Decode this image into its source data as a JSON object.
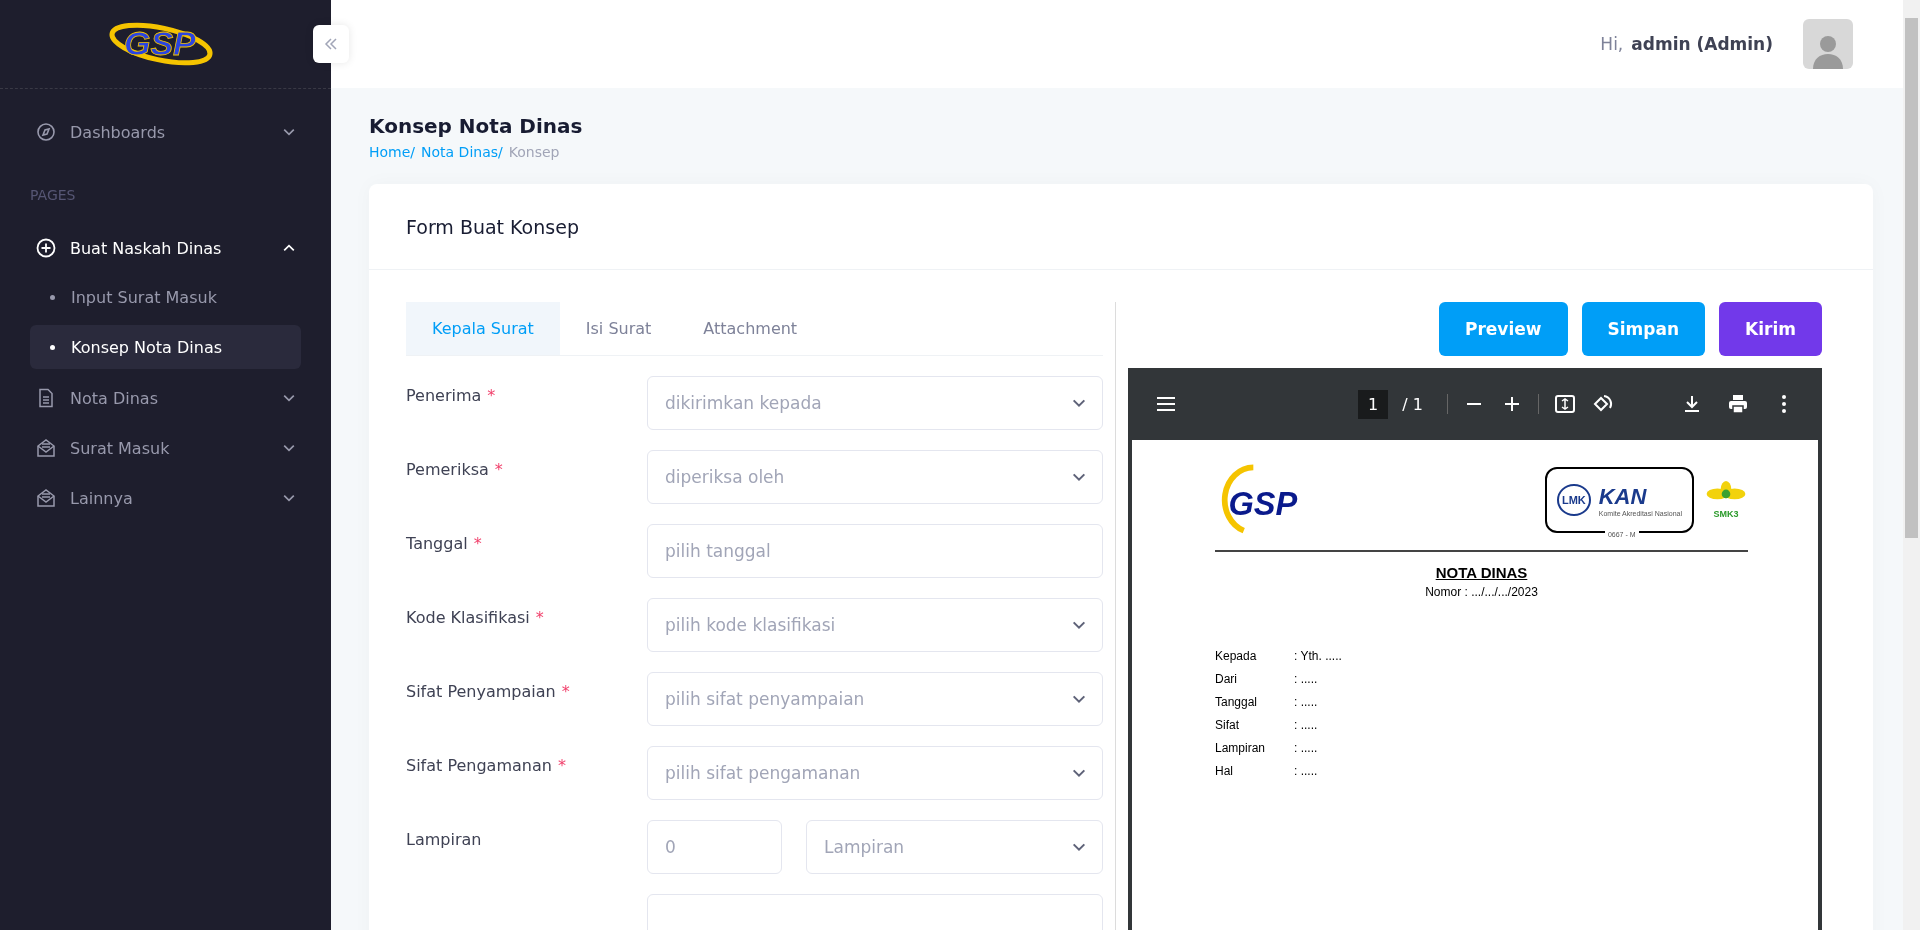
{
  "sidebar": {
    "logo": "GSP",
    "items": [
      {
        "label": "Dashboards",
        "expanded": false
      },
      {
        "label": "Buat Naskah Dinas",
        "expanded": true,
        "section": "PAGES",
        "children": [
          {
            "label": "Input Surat Masuk",
            "selected": false
          },
          {
            "label": "Konsep Nota Dinas",
            "selected": true
          }
        ]
      },
      {
        "label": "Nota Dinas",
        "expanded": false
      },
      {
        "label": "Surat Masuk",
        "expanded": false
      },
      {
        "label": "Lainnya",
        "expanded": false
      }
    ]
  },
  "header": {
    "greeting": "Hi,",
    "user": "admin (Admin)"
  },
  "page": {
    "title": "Konsep Nota Dinas",
    "breadcrumb": [
      {
        "label": "Home/",
        "link": true
      },
      {
        "label": "Nota Dinas/",
        "link": true
      },
      {
        "label": "Konsep",
        "link": false
      }
    ]
  },
  "card": {
    "title": "Form Buat Konsep",
    "tabs": [
      {
        "label": "Kepala Surat",
        "selected": true
      },
      {
        "label": "Isi Surat",
        "selected": false
      },
      {
        "label": "Attachment",
        "selected": false
      }
    ],
    "fields": [
      {
        "kind": "select",
        "label": "Penerima",
        "required_mark": "*",
        "placeholder": "dikirimkan kepada"
      },
      {
        "kind": "select",
        "label": "Pemeriksa",
        "required_mark": "*",
        "placeholder": "diperiksa oleh"
      },
      {
        "kind": "text",
        "label": "Tanggal",
        "required_mark": "*",
        "placeholder": "pilih tanggal"
      },
      {
        "kind": "select",
        "label": "Kode Klasifikasi",
        "required_mark": "*",
        "placeholder": "pilih kode klasifikasi"
      },
      {
        "kind": "select",
        "label": "Sifat Penyampaian",
        "required_mark": "*",
        "placeholder": "pilih sifat penyampaian"
      },
      {
        "kind": "select",
        "label": "Sifat Pengamanan",
        "required_mark": "*",
        "placeholder": "pilih sifat pengamanan"
      },
      {
        "kind": "pair",
        "label": "Lampiran",
        "placeholder": "0",
        "placeholder_2": "Lampiran"
      },
      {
        "kind": "text"
      }
    ],
    "buttons": [
      {
        "label": "Preview",
        "color": "#009ef7"
      },
      {
        "label": "Simpan",
        "color": "#009ef7"
      },
      {
        "label": "Kirim",
        "color": "#7239ea"
      }
    ],
    "viewer": {
      "page": "1",
      "total": "/ 1",
      "document": {
        "logo": "GSP",
        "cert": [
          "LMK",
          "KAN",
          "Komite Akreditasi Nasional",
          "0667 - M",
          "SMK3"
        ],
        "title": "NOTA DINAS",
        "number": "Nomor : .../.../.../2023",
        "rows": [
          {
            "label": "Kepada",
            "value": ": Yth. ....."
          },
          {
            "label": "Dari",
            "value": ": ....."
          },
          {
            "label": "Tanggal",
            "value": ": ....."
          },
          {
            "label": "Sifat",
            "value": ": ....."
          },
          {
            "label": "Lampiran",
            "value": ": ....."
          },
          {
            "label": "Hal",
            "value": ": ....."
          }
        ]
      }
    }
  }
}
